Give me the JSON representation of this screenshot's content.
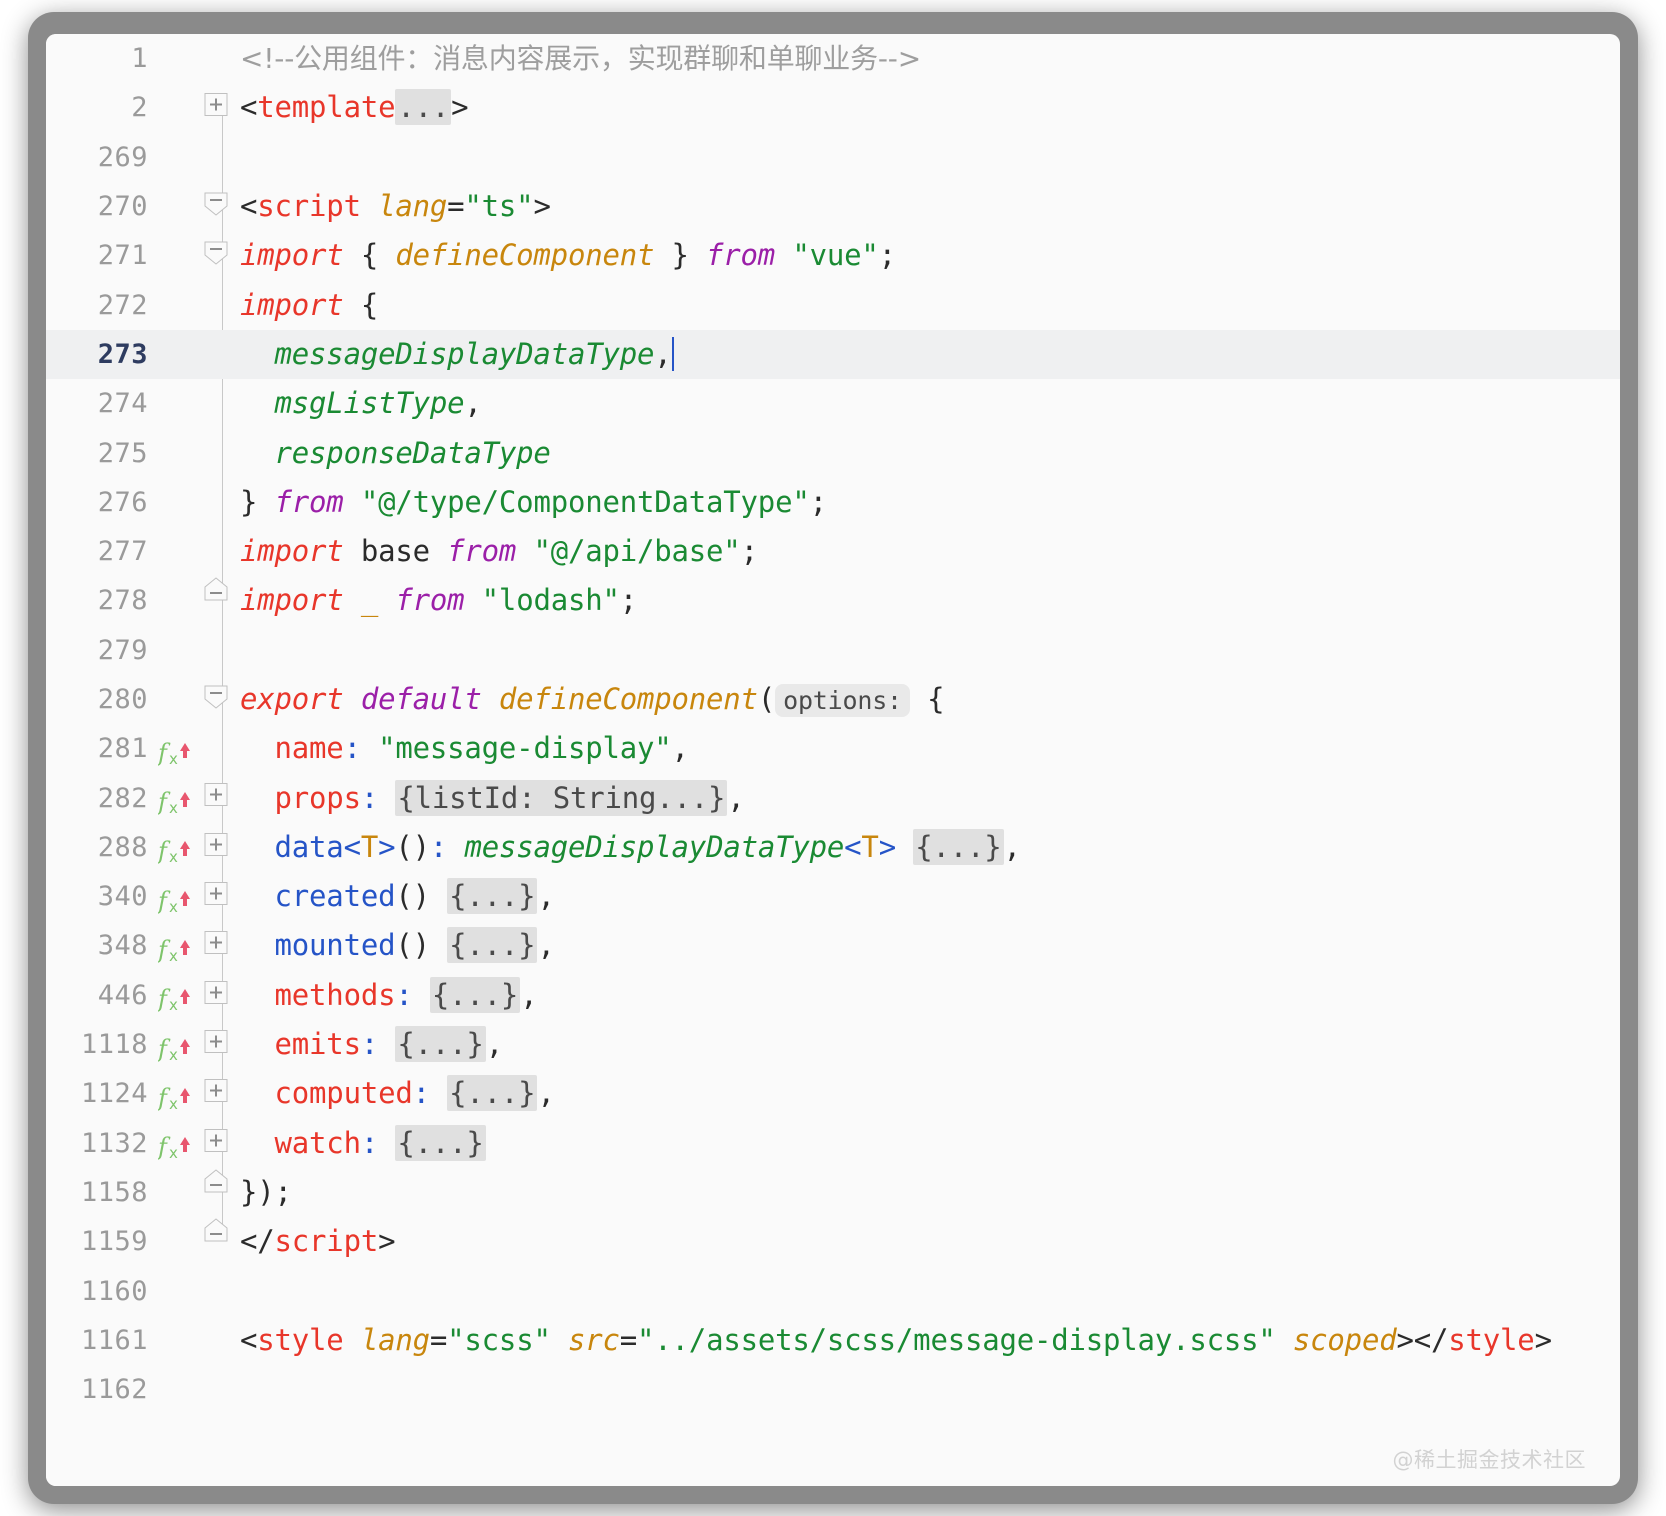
{
  "window": {
    "frame_color": "#8a8a8a",
    "editor_bg": "#fafafa"
  },
  "watermark": {
    "text": "@稀土掘金技术社区"
  },
  "theme": {
    "tag": "#e8362a",
    "string": "#1a8a33",
    "keyword": "#e8362a",
    "keyword_from": "#9b1fa8",
    "function": "#c8860d",
    "type": "#1a8a33",
    "property": "#e8362a",
    "identifier_blue": "#2554c7",
    "comment": "#9e9e9e",
    "folded_bg": "#e0e0e0",
    "caret_line_bg": "#eff0f1",
    "caret_color": "#2554c7",
    "lineno_color": "#9a9a9a",
    "lineno_active_color": "#2e3c60"
  },
  "gutter_icons": {
    "implementing_member": "implementing-member-icon",
    "fold_expand": "fold-expand-icon",
    "fold_collapse": "fold-collapse-icon",
    "fold_end": "fold-end-icon"
  },
  "editor": {
    "language": "Vue SFC (TypeScript)",
    "caret_line": 273,
    "lines": [
      {
        "number": "1",
        "fx": false,
        "fold": "none",
        "caret": false,
        "indent": 0,
        "tokens": [
          {
            "t": "comment",
            "v": "<!--公用组件：消息内容展示，实现群聊和单聊业务-->"
          }
        ]
      },
      {
        "number": "2",
        "fx": false,
        "fold": "expand",
        "caret": false,
        "indent": 0,
        "tokens": [
          {
            "t": "punc",
            "v": "<"
          },
          {
            "t": "tag",
            "v": "template"
          },
          {
            "t": "folded",
            "v": "..."
          },
          {
            "t": "punc",
            "v": ">"
          }
        ]
      },
      {
        "number": "269",
        "fx": false,
        "fold": "none",
        "caret": false,
        "indent": 0,
        "tokens": []
      },
      {
        "number": "270",
        "fx": false,
        "fold": "collapse",
        "caret": false,
        "indent": 0,
        "tokens": [
          {
            "t": "punc",
            "v": "<"
          },
          {
            "t": "tag",
            "v": "script"
          },
          {
            "t": "punc",
            "v": " "
          },
          {
            "t": "attr",
            "v": "lang"
          },
          {
            "t": "punc",
            "v": "="
          },
          {
            "t": "str",
            "v": "\"ts\""
          },
          {
            "t": "punc",
            "v": ">"
          }
        ]
      },
      {
        "number": "271",
        "fx": false,
        "fold": "collapse",
        "caret": false,
        "indent": 0,
        "tokens": [
          {
            "t": "kw",
            "v": "import"
          },
          {
            "t": "punc",
            "v": " { "
          },
          {
            "t": "fn",
            "v": "defineComponent"
          },
          {
            "t": "punc",
            "v": " } "
          },
          {
            "t": "kw2",
            "v": "from"
          },
          {
            "t": "punc",
            "v": " "
          },
          {
            "t": "str",
            "v": "\"vue\""
          },
          {
            "t": "punc",
            "v": ";"
          }
        ]
      },
      {
        "number": "272",
        "fx": false,
        "fold": "none",
        "caret": false,
        "indent": 0,
        "tokens": [
          {
            "t": "kw",
            "v": "import"
          },
          {
            "t": "punc",
            "v": " {"
          }
        ]
      },
      {
        "number": "273",
        "fx": false,
        "fold": "none",
        "caret": true,
        "indent": 1,
        "tokens": [
          {
            "t": "typ",
            "v": "messageDisplayDataType"
          },
          {
            "t": "punc",
            "v": ","
          }
        ]
      },
      {
        "number": "274",
        "fx": false,
        "fold": "none",
        "caret": false,
        "indent": 1,
        "tokens": [
          {
            "t": "typ",
            "v": "msgListType"
          },
          {
            "t": "punc",
            "v": ","
          }
        ]
      },
      {
        "number": "275",
        "fx": false,
        "fold": "none",
        "caret": false,
        "indent": 1,
        "tokens": [
          {
            "t": "typ",
            "v": "responseDataType"
          }
        ]
      },
      {
        "number": "276",
        "fx": false,
        "fold": "none",
        "caret": false,
        "indent": 0,
        "tokens": [
          {
            "t": "punc",
            "v": "} "
          },
          {
            "t": "kw2",
            "v": "from"
          },
          {
            "t": "punc",
            "v": " "
          },
          {
            "t": "str",
            "v": "\"@/type/ComponentDataType\""
          },
          {
            "t": "punc",
            "v": ";"
          }
        ]
      },
      {
        "number": "277",
        "fx": false,
        "fold": "none",
        "caret": false,
        "indent": 0,
        "tokens": [
          {
            "t": "kw",
            "v": "import"
          },
          {
            "t": "punc",
            "v": " base "
          },
          {
            "t": "kw2",
            "v": "from"
          },
          {
            "t": "punc",
            "v": " "
          },
          {
            "t": "str",
            "v": "\"@/api/base\""
          },
          {
            "t": "punc",
            "v": ";"
          }
        ]
      },
      {
        "number": "278",
        "fx": false,
        "fold": "end",
        "caret": false,
        "indent": 0,
        "tokens": [
          {
            "t": "kw",
            "v": "import"
          },
          {
            "t": "punc",
            "v": " "
          },
          {
            "t": "gen",
            "v": "_"
          },
          {
            "t": "punc",
            "v": " "
          },
          {
            "t": "kw2",
            "v": "from"
          },
          {
            "t": "punc",
            "v": " "
          },
          {
            "t": "str",
            "v": "\"lodash\""
          },
          {
            "t": "punc",
            "v": ";"
          }
        ]
      },
      {
        "number": "279",
        "fx": false,
        "fold": "none",
        "caret": false,
        "indent": 0,
        "tokens": []
      },
      {
        "number": "280",
        "fx": false,
        "fold": "collapse",
        "caret": false,
        "indent": 0,
        "tokens": [
          {
            "t": "kw",
            "v": "export"
          },
          {
            "t": "punc",
            "v": " "
          },
          {
            "t": "kw2",
            "v": "default"
          },
          {
            "t": "punc",
            "v": " "
          },
          {
            "t": "fn",
            "v": "defineComponent"
          },
          {
            "t": "punc",
            "v": "("
          },
          {
            "t": "hint",
            "v": "options:"
          },
          {
            "t": "punc",
            "v": " {"
          }
        ]
      },
      {
        "number": "281",
        "fx": true,
        "fold": "none",
        "caret": false,
        "indent": 1,
        "tokens": [
          {
            "t": "prop",
            "v": "name"
          },
          {
            "t": "blu",
            "v": ":"
          },
          {
            "t": "punc",
            "v": " "
          },
          {
            "t": "str",
            "v": "\"message-display\""
          },
          {
            "t": "punc",
            "v": ","
          }
        ]
      },
      {
        "number": "282",
        "fx": true,
        "fold": "expand",
        "caret": false,
        "indent": 1,
        "tokens": [
          {
            "t": "prop",
            "v": "props"
          },
          {
            "t": "blu",
            "v": ":"
          },
          {
            "t": "punc",
            "v": " "
          },
          {
            "t": "folded",
            "v": "{listId: String...}"
          },
          {
            "t": "punc",
            "v": ","
          }
        ]
      },
      {
        "number": "288",
        "fx": true,
        "fold": "expand",
        "caret": false,
        "indent": 1,
        "tokens": [
          {
            "t": "blu",
            "v": "data"
          },
          {
            "t": "blu",
            "v": "<"
          },
          {
            "t": "gen",
            "v": "T"
          },
          {
            "t": "blu",
            "v": ">"
          },
          {
            "t": "punc",
            "v": "()"
          },
          {
            "t": "blu",
            "v": ":"
          },
          {
            "t": "punc",
            "v": " "
          },
          {
            "t": "typ",
            "v": "messageDisplayDataType"
          },
          {
            "t": "blu",
            "v": "<"
          },
          {
            "t": "gen",
            "v": "T"
          },
          {
            "t": "blu",
            "v": ">"
          },
          {
            "t": "punc",
            "v": " "
          },
          {
            "t": "folded",
            "v": "{...}"
          },
          {
            "t": "punc",
            "v": ","
          }
        ]
      },
      {
        "number": "340",
        "fx": true,
        "fold": "expand",
        "caret": false,
        "indent": 1,
        "tokens": [
          {
            "t": "blu",
            "v": "created"
          },
          {
            "t": "punc",
            "v": "() "
          },
          {
            "t": "folded",
            "v": "{...}"
          },
          {
            "t": "punc",
            "v": ","
          }
        ]
      },
      {
        "number": "348",
        "fx": true,
        "fold": "expand",
        "caret": false,
        "indent": 1,
        "tokens": [
          {
            "t": "blu",
            "v": "mounted"
          },
          {
            "t": "punc",
            "v": "() "
          },
          {
            "t": "folded",
            "v": "{...}"
          },
          {
            "t": "punc",
            "v": ","
          }
        ]
      },
      {
        "number": "446",
        "fx": true,
        "fold": "expand",
        "caret": false,
        "indent": 1,
        "tokens": [
          {
            "t": "prop",
            "v": "methods"
          },
          {
            "t": "blu",
            "v": ":"
          },
          {
            "t": "punc",
            "v": " "
          },
          {
            "t": "folded",
            "v": "{...}"
          },
          {
            "t": "punc",
            "v": ","
          }
        ]
      },
      {
        "number": "1118",
        "fx": true,
        "fold": "expand",
        "caret": false,
        "indent": 1,
        "tokens": [
          {
            "t": "prop",
            "v": "emits"
          },
          {
            "t": "blu",
            "v": ":"
          },
          {
            "t": "punc",
            "v": " "
          },
          {
            "t": "folded",
            "v": "{...}"
          },
          {
            "t": "punc",
            "v": ","
          }
        ]
      },
      {
        "number": "1124",
        "fx": true,
        "fold": "expand",
        "caret": false,
        "indent": 1,
        "tokens": [
          {
            "t": "prop",
            "v": "computed"
          },
          {
            "t": "blu",
            "v": ":"
          },
          {
            "t": "punc",
            "v": " "
          },
          {
            "t": "folded",
            "v": "{...}"
          },
          {
            "t": "punc",
            "v": ","
          }
        ]
      },
      {
        "number": "1132",
        "fx": true,
        "fold": "expand",
        "caret": false,
        "indent": 1,
        "tokens": [
          {
            "t": "prop",
            "v": "watch"
          },
          {
            "t": "blu",
            "v": ":"
          },
          {
            "t": "punc",
            "v": " "
          },
          {
            "t": "folded",
            "v": "{...}"
          }
        ]
      },
      {
        "number": "1158",
        "fx": false,
        "fold": "end",
        "caret": false,
        "indent": 0,
        "tokens": [
          {
            "t": "punc",
            "v": "});"
          }
        ]
      },
      {
        "number": "1159",
        "fx": false,
        "fold": "end",
        "caret": false,
        "indent": 0,
        "tokens": [
          {
            "t": "punc",
            "v": "</"
          },
          {
            "t": "tag",
            "v": "script"
          },
          {
            "t": "punc",
            "v": ">"
          }
        ]
      },
      {
        "number": "1160",
        "fx": false,
        "fold": "none",
        "caret": false,
        "indent": 0,
        "tokens": []
      },
      {
        "number": "1161",
        "fx": false,
        "fold": "none",
        "caret": false,
        "indent": 0,
        "tokens": [
          {
            "t": "punc",
            "v": "<"
          },
          {
            "t": "tag",
            "v": "style"
          },
          {
            "t": "punc",
            "v": " "
          },
          {
            "t": "attr",
            "v": "lang"
          },
          {
            "t": "punc",
            "v": "="
          },
          {
            "t": "str",
            "v": "\"scss\""
          },
          {
            "t": "punc",
            "v": " "
          },
          {
            "t": "attr",
            "v": "src"
          },
          {
            "t": "punc",
            "v": "="
          },
          {
            "t": "str",
            "v": "\"../assets/scss/message-display.scss\""
          },
          {
            "t": "punc",
            "v": " "
          },
          {
            "t": "attr",
            "v": "scoped"
          },
          {
            "t": "punc",
            "v": "></"
          },
          {
            "t": "tag",
            "v": "style"
          },
          {
            "t": "punc",
            "v": ">"
          }
        ]
      },
      {
        "number": "1162",
        "fx": false,
        "fold": "none",
        "caret": false,
        "indent": 0,
        "tokens": []
      }
    ]
  }
}
